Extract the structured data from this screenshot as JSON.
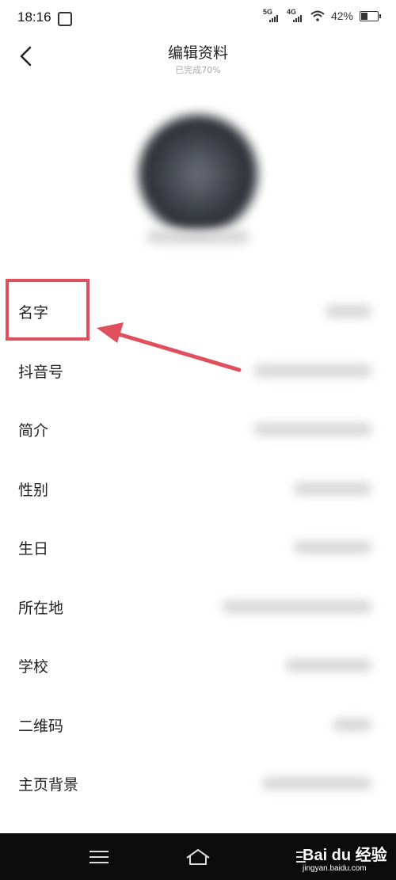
{
  "status_bar": {
    "time": "18:16",
    "network_1": "5G",
    "network_2": "4G",
    "battery": "42%"
  },
  "header": {
    "title": "编辑资料",
    "subtitle": "已完成70%"
  },
  "profile": {
    "items": [
      {
        "label": "名字"
      },
      {
        "label": "抖音号"
      },
      {
        "label": "简介"
      },
      {
        "label": "性别"
      },
      {
        "label": "生日"
      },
      {
        "label": "所在地"
      },
      {
        "label": "学校"
      },
      {
        "label": "二维码"
      },
      {
        "label": "主页背景"
      }
    ]
  },
  "watermark": {
    "brand": "Bai du 经验",
    "url": "jingyan.baidu.com"
  },
  "colors": {
    "highlight": "#e0505c",
    "nav_bar": "#0c0c0c"
  },
  "icons": [
    "notification-icon",
    "wifi-icon",
    "battery-icon",
    "back-arrow-icon",
    "menu-icon",
    "home-icon",
    "nav-back-icon"
  ]
}
